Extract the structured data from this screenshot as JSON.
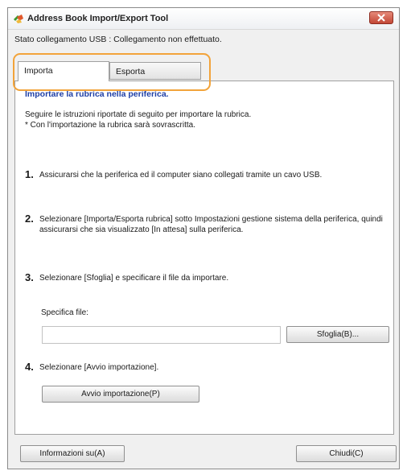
{
  "window": {
    "title": "Address Book Import/Export Tool"
  },
  "status": "Stato collegamento USB : Collegamento non effettuato.",
  "tabs": [
    {
      "label": "Importa",
      "selected": true
    },
    {
      "label": "Esporta",
      "selected": false
    }
  ],
  "panel": {
    "heading": "Importare la rubrica nella periferica.",
    "intro": [
      "Seguire le istruzioni riportate di seguito per importare la rubrica.",
      "* Con l'importazione la rubrica sarà sovrascritta."
    ],
    "steps": [
      {
        "num": "1.",
        "text": "Assicurarsi che la periferica ed il computer siano collegati tramite un cavo USB."
      },
      {
        "num": "2.",
        "text": "Selezionare [Importa/Esporta rubrica] sotto Impostazioni gestione sistema della periferica, quindi assicurarsi che sia visualizzato [In attesa] sulla periferica."
      },
      {
        "num": "3.",
        "text": "Selezionare [Sfoglia] e specificare il file da importare."
      },
      {
        "num": "4.",
        "text": "Selezionare [Avvio importazione]."
      }
    ],
    "file": {
      "label": "Specifica file:",
      "value": "",
      "browse_label": "Sfoglia(B)..."
    },
    "start_label": "Avvio importazione(P)"
  },
  "footer": {
    "info_label": "Informazioni su(A)",
    "close_label": "Chiudi(C)"
  },
  "colors": {
    "heading": "#1f3fa6",
    "highlight": "#f2a33a",
    "close_button": "#c24836"
  }
}
